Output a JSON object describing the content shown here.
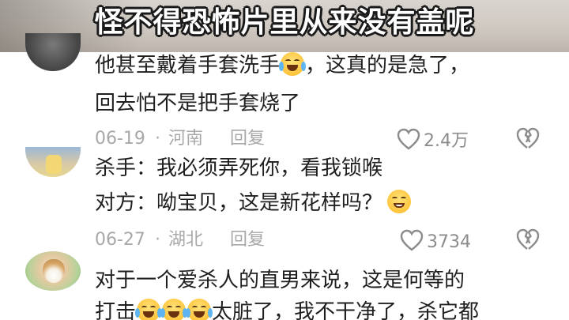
{
  "caption": "怪不得恐怖片里从来没有盖呢",
  "comments": [
    {
      "line1_a": "他甚至戴着手套洗手",
      "line1_b": "，这真的是急了，",
      "line2": "回去怕不是把手套烧了",
      "date": "06-19",
      "dot": "·",
      "location": "河南",
      "reply": "回复",
      "likes": "2.4万"
    },
    {
      "line1": "杀手：我必须弄死你，看我锁喉",
      "line2": "对方：呦宝贝，这是新花样吗？",
      "date": "06-27",
      "dot": "·",
      "location": "湖北",
      "reply": "回复",
      "likes": "3734"
    },
    {
      "line1": "对于一个爱杀人的直男来说，这是何等的",
      "line2_a": "打击",
      "line2_b": "太脏了，我不干净了，杀它都"
    }
  ],
  "icons": {
    "like": "heart-outline-icon",
    "dislike": "broken-heart-icon",
    "emoji_crying": "crying-laughing-emoji",
    "emoji_smile": "smiling-emoji"
  },
  "colors": {
    "meta_text": "#a8a8a8",
    "body_text": "#1f1f1f",
    "caption_text": "#ffffff"
  }
}
